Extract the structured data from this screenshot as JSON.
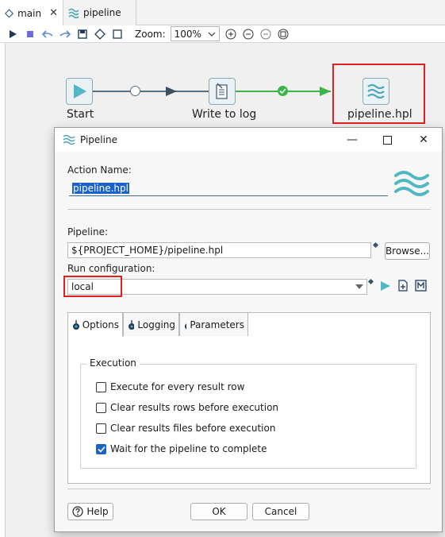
{
  "tabs": [
    {
      "label": "main"
    },
    {
      "label": "pipeline"
    }
  ],
  "toolbar": {
    "zoom_label": "Zoom:",
    "zoom_value": "100%"
  },
  "canvas": {
    "nodes": [
      {
        "label": "Start"
      },
      {
        "label": "Write to log"
      },
      {
        "label": "pipeline.hpl"
      }
    ]
  },
  "dialog": {
    "title": "Pipeline",
    "action_name_label": "Action Name:",
    "action_name_value": "pipeline.hpl",
    "pipeline_label": "Pipeline:",
    "pipeline_value": "${PROJECT_HOME}/pipeline.hpl",
    "browse_label": "Browse...",
    "run_config_label": "Run configuration:",
    "run_config_value": "local",
    "tabs": [
      {
        "label": "Options"
      },
      {
        "label": "Logging"
      },
      {
        "label": "Parameters"
      }
    ],
    "execution_group_title": "Execution",
    "checkboxes": [
      {
        "label": "Execute for every result row",
        "checked": false
      },
      {
        "label": "Clear results rows before execution",
        "checked": false
      },
      {
        "label": "Clear results files before execution",
        "checked": false
      },
      {
        "label": "Wait for the pipeline to complete",
        "checked": true
      }
    ],
    "help_label": "Help",
    "ok_label": "OK",
    "cancel_label": "Cancel"
  },
  "colors": {
    "accent": "#1b63c9",
    "teal": "#4fa8b8",
    "highlight_red": "#e02020",
    "hop_green": "#3bb54a"
  }
}
